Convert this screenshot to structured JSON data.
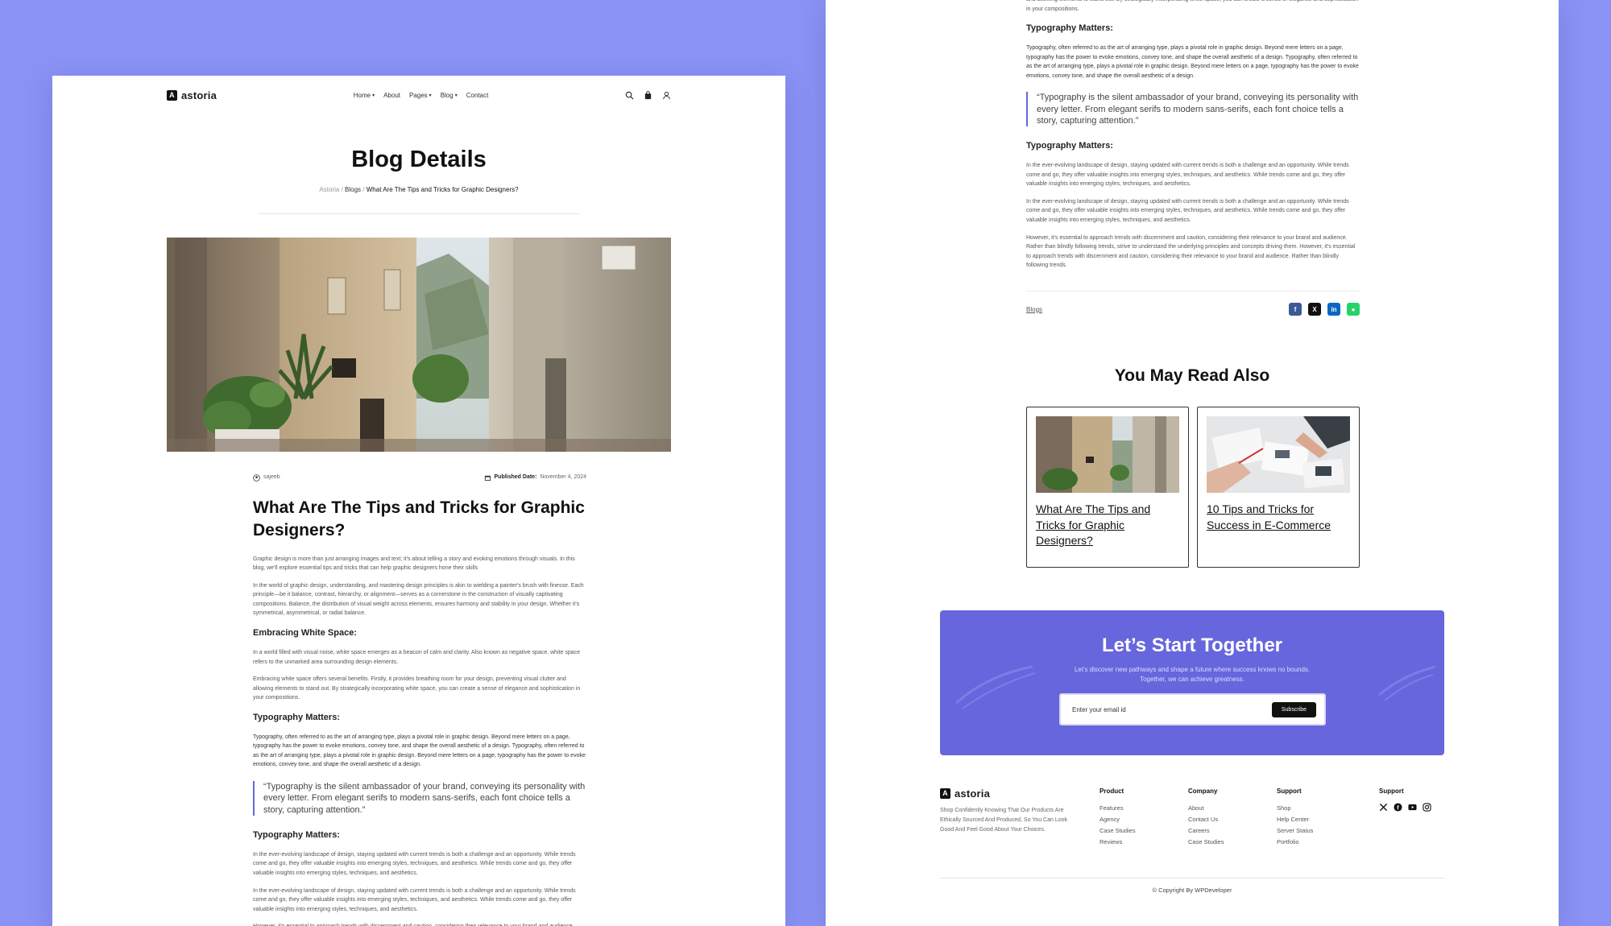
{
  "brand": {
    "name": "astoria",
    "mark": "A"
  },
  "nav": {
    "items": [
      {
        "label": "Home",
        "dropdown": true
      },
      {
        "label": "About",
        "dropdown": false
      },
      {
        "label": "Pages",
        "dropdown": true
      },
      {
        "label": "Blog",
        "dropdown": true
      },
      {
        "label": "Contact",
        "dropdown": false
      }
    ],
    "icons": [
      "search-icon",
      "bag-icon",
      "user-icon"
    ]
  },
  "page": {
    "title": "Blog Details",
    "breadcrumb": {
      "home": "Astoria",
      "sep": "/",
      "section": "Blogs",
      "current": "What Are The Tips and Tricks for Graphic Designers?"
    }
  },
  "post": {
    "author": "sajeeb",
    "published_label": "Published Date:",
    "published_date": "November 4, 2024",
    "title": "What Are The Tips and Tricks for Graphic Designers?",
    "intro": "Graphic design is more than just arranging images and text; it's about telling a story and evoking emotions through visuals. In this blog, we'll explore essential tips and tricks that can help graphic designers hone their skills",
    "p1": "In the world of graphic design, understanding, and mastering design principles is akin to wielding a painter's brush with finesse. Each principle—be it balance, contrast, hierarchy, or alignment—serves as a cornerstone in the construction of visually captivating compositions. Balance, the distribution of visual weight across elements, ensures harmony and stability in your design. Whether it's symmetrical, asymmetrical, or radial balance.",
    "h_white_space": "Embracing White Space:",
    "p2": "In a world filled with visual noise, white space emerges as a beacon of calm and clarity. Also known as negative space, white space refers to the unmarked area surrounding design elements.",
    "p3": "Embracing white space offers several benefits. Firstly, it provides breathing room for your design, preventing visual clutter and allowing elements to stand out. By strategically incorporating white space, you can create a sense of elegance and sophistication in your compositions.",
    "h_typography": "Typography Matters:",
    "p4": "Typography, often referred to as the art of arranging type, plays a pivotal role in graphic design. Beyond mere letters on a page, typography has the power to evoke emotions, convey tone, and shape the overall aesthetic of a design. Typography, often referred to as the art of arranging type, plays a pivotal role in graphic design. Beyond mere letters on a page, typography has the power to evoke emotions, convey tone, and shape the overall aesthetic of a design.",
    "quote": "“Typography is the silent ambassador of your brand, conveying its personality with every letter. From elegant serifs to modern sans-serifs, each font choice tells a story, capturing attention.”",
    "h_typography_2": "Typography Matters:",
    "p5": "In the ever-evolving landscape of design, staying updated with current trends is both a challenge and an opportunity. While trends come and go, they offer valuable insights into emerging styles, techniques, and aesthetics. While trends come and go, they offer valuable insights into emerging styles, techniques, and aesthetics.",
    "p6": "In the ever-evolving landscape of design, staying updated with current trends is both a challenge and an opportunity. While trends come and go, they offer valuable insights into emerging styles, techniques, and aesthetics. While trends come and go, they offer valuable insights into emerging styles, techniques, and aesthetics.",
    "p7": "However, it's essential to approach trends with discernment and caution, considering their relevance to your brand and audience. Rather than blindly following trends, strive to understand the underlying principles and concepts driving them. However, it's essential to approach trends with discernment and caution, considering their relevance to your brand and audience. Rather than blindly following trends.",
    "p3_tail": "and allowing elements to stand out. By strategically incorporating white space, you can create a sense of elegance and sophistication in your compositions.",
    "tag": "Blogs",
    "share": [
      {
        "icon": "facebook-icon",
        "glyph": "f",
        "color": "#3b5998"
      },
      {
        "icon": "x-icon",
        "glyph": "X",
        "color": "#111111"
      },
      {
        "icon": "linkedin-icon",
        "glyph": "in",
        "color": "#0a66c2"
      },
      {
        "icon": "whatsapp-icon",
        "glyph": "●",
        "color": "#25d366"
      }
    ]
  },
  "related": {
    "title": "You May Read Also",
    "items": [
      {
        "title": "What Are The Tips and Tricks for Graphic Designers?"
      },
      {
        "title": "10 Tips and Tricks for Success in E-Commerce"
      }
    ]
  },
  "newsletter": {
    "title": "Let’s Start Together",
    "subtitle": "Let's discover new pathways and shape a future where success knows no bounds. Together, we can achieve greatness.",
    "placeholder": "Enter your email id",
    "button": "Subscribe",
    "bg": "#6766dc"
  },
  "footer": {
    "description": "Shop Confidently Knowing That Our Products Are Ethically Sourced And Produced, So You Can Look Good And Feel Good About Your Choices.",
    "columns": [
      {
        "title": "Product",
        "links": [
          "Features",
          "Agency",
          "Case Studies",
          "Reviews"
        ]
      },
      {
        "title": "Company",
        "links": [
          "About",
          "Contact Us",
          "Careers",
          "Case Studies"
        ]
      },
      {
        "title": "Support",
        "links": [
          "Shop",
          "Help Center",
          "Server Status",
          "Portfolio"
        ]
      }
    ],
    "social_title": "Support",
    "social": [
      "x-icon",
      "facebook-icon",
      "youtube-icon",
      "instagram-icon"
    ],
    "copyright": "© Copyright By WPDeveloper"
  },
  "colors": {
    "background": "#8a92f5",
    "accent": "#6766dc"
  }
}
